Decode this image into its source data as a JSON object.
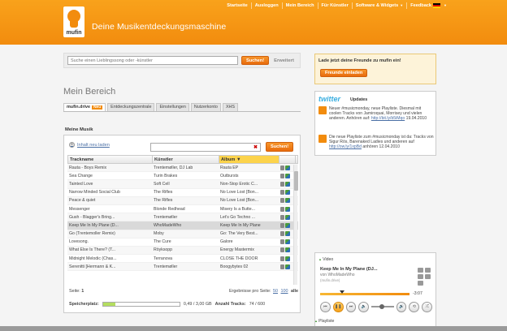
{
  "topnav": [
    {
      "label": "Startseite"
    },
    {
      "label": "Ausloggen"
    },
    {
      "label": "Mein Bereich"
    },
    {
      "label": "Für Künstler"
    },
    {
      "label": "Software & Widgets"
    },
    {
      "label": "Feedback"
    }
  ],
  "brand": {
    "wordmark": "mufin",
    "tagline": "Deine Musikentdeckungsmaschine",
    "accent": "#f28c0e"
  },
  "search": {
    "placeholder": "Suche einen Lieblingssong oder -künstler",
    "button": "Suchen!",
    "advanced": "Erweitert"
  },
  "page_title": "Mein Bereich",
  "tabs": [
    {
      "label": "mufin.drive",
      "badge": "Neu"
    },
    {
      "label": "Entdeckungszentrale"
    },
    {
      "label": "Einstellungen"
    },
    {
      "label": "Nutzerkonto"
    },
    {
      "label": "XHS"
    }
  ],
  "music": {
    "section_title": "Meine Musik",
    "upload_label": "Inhalt neu laden",
    "filter_value": "",
    "search_button": "Suchen!",
    "columns": [
      "Trackname",
      "Künstler",
      "Album"
    ],
    "rows": [
      [
        "Rauta - Boys Remix",
        "Trentemøller, DJ Lab",
        "Rauta EP"
      ],
      [
        "Sea Change",
        "Turin Brakes",
        "Outbursts"
      ],
      [
        "Tainted Love",
        "Soft Cell",
        "Non-Stop Erotic C..."
      ],
      [
        "Narrow Minded Social Club",
        "The Rifles",
        "No Love Lost [Bon..."
      ],
      [
        "Peace & quiet",
        "The Rifles",
        "No Love Lost [Bon..."
      ],
      [
        "Messenger",
        "Blonde Redhead",
        "Misery Is a Butte..."
      ],
      [
        "Gush - Blagger's Bring...",
        "Trentemøller",
        "Let's Go Techno ..."
      ],
      [
        "Keep Me In My Plane (D...",
        "WhoMadeWho",
        "Keep Me In My Plane"
      ],
      [
        "Go (Trentemoller Remix)",
        "Moby",
        "Go: The Very Best..."
      ],
      [
        "Lovesong.",
        "The Cure",
        "Galore"
      ],
      [
        "What Else Is There? (T...",
        "Röyksopp",
        "Energy Mastermix"
      ],
      [
        "Midnight Melodic (Chas...",
        "Terranova",
        "CLOSE THE DOOR"
      ],
      [
        "Serenitti [Hermann & K...",
        "Trentemøller",
        "Boogybytes 02"
      ]
    ],
    "selected_row": 7,
    "pager": {
      "page_label": "Seite:",
      "page": "1",
      "per_page_label": "Ergebnisse pro Seite:",
      "opt1": "50",
      "opt2": "100",
      "all": "alle"
    },
    "storage": {
      "label": "Speicherplatz:",
      "used": "0,49 / 3,00 GB",
      "fraction": 0.16,
      "tracks_label": "Anzahl Tracks:",
      "tracks": "74 / 600"
    }
  },
  "invite": {
    "title": "Lade jetzt deine Freunde zu mufin ein!",
    "button": "Freunde einladen"
  },
  "twitter": {
    "logo": "twitter",
    "updates": "Updates",
    "tweets": [
      {
        "text": "Neuer #musicmonday, neue Playliste. Diesmal mit coolen Tracks von Jamiroquai, Morrisey und vielen anderen. Anhören auf:",
        "link": "http://bit.ly/b5iMqo",
        "date": "19.04.2010"
      },
      {
        "text": "Die neue Playliste zum #musicmonday ist da: Tracks von Sigur Rós, Barenaked Ladies und anderen auf",
        "link": "http://ow.ly/1xpBd",
        "tail": "anhören",
        "date": "12.04.2010"
      }
    ]
  },
  "player": {
    "video_label": "Video",
    "title": "Keep Me In My Plane (DJ...",
    "artist": "von WhoMadeWho",
    "source": "(mufin.drive)",
    "time": "-3:07",
    "progress": 0.22,
    "playlist_label": "Playliste"
  }
}
